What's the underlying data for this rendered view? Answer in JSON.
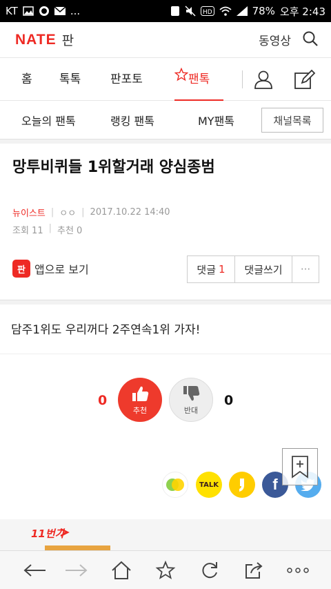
{
  "statusbar": {
    "carrier": "KT",
    "battery": "78%",
    "time": "오후 2:43",
    "dots": "..."
  },
  "header": {
    "logo_nate": "NATE",
    "logo_pan": "판",
    "video_link": "동영상"
  },
  "tabs": [
    {
      "label": "홈"
    },
    {
      "label": "톡톡"
    },
    {
      "label": "판포토"
    },
    {
      "label": "팬톡",
      "active": true
    }
  ],
  "subtabs": [
    {
      "label": "오늘의 팬톡"
    },
    {
      "label": "랭킹 팬톡"
    },
    {
      "label": "MY팬톡"
    }
  ],
  "channel_button": "채널목록",
  "article": {
    "title": "망투비퀴들 1위할거래 양심종범",
    "author": "뉴이스트",
    "nick": "ㅇㅇ",
    "datetime": "2017.10.22 14:40",
    "views": "조회 11",
    "recommends": "추천 0",
    "app_view": "앱으로 보기",
    "app_icon_text": "판",
    "comment_label": "댓글",
    "comment_count": "1",
    "write_comment": "댓글쓰기",
    "more": "···",
    "body": "담주1위도 우리꺼다 2주연속1위 가자!"
  },
  "vote": {
    "up_count": "0",
    "up_label": "추천",
    "down_count": "0",
    "down_label": "반대"
  },
  "share": {
    "talk_label": "TALK",
    "facebook_label": "f"
  },
  "ad": {
    "brand": "11번가"
  },
  "colors": {
    "accent": "#ee2a24"
  }
}
